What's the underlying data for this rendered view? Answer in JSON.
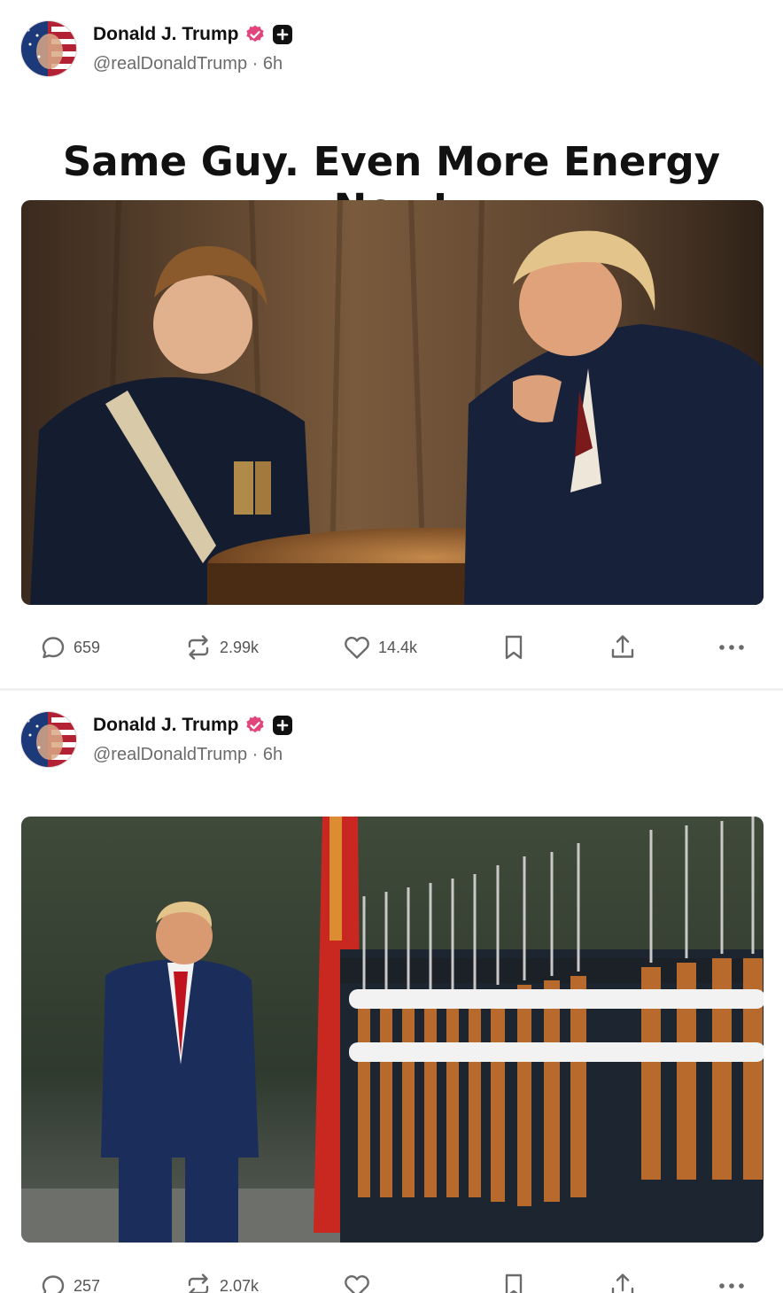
{
  "posts": [
    {
      "author": {
        "name": "Donald J. Trump",
        "handle": "@realDonaldTrump",
        "separator": "·",
        "time": "6h",
        "verified_color": "#e2457b"
      },
      "text": "Same Guy. Even More Energy Now!",
      "stats": {
        "replies": "659",
        "reposts": "2.99k",
        "likes": "14.4k"
      }
    },
    {
      "author": {
        "name": "Donald J. Trump",
        "handle": "@realDonaldTrump",
        "separator": "·",
        "time": "6h",
        "verified_color": "#e2457b"
      },
      "text": "",
      "stats": {
        "replies": "257",
        "reposts": "2.07k",
        "likes": ""
      }
    }
  ],
  "icons": [
    "reply-icon",
    "repost-icon",
    "like-icon",
    "bookmark-icon",
    "share-icon",
    "more-icon",
    "verified-icon",
    "plus-badge-icon"
  ]
}
